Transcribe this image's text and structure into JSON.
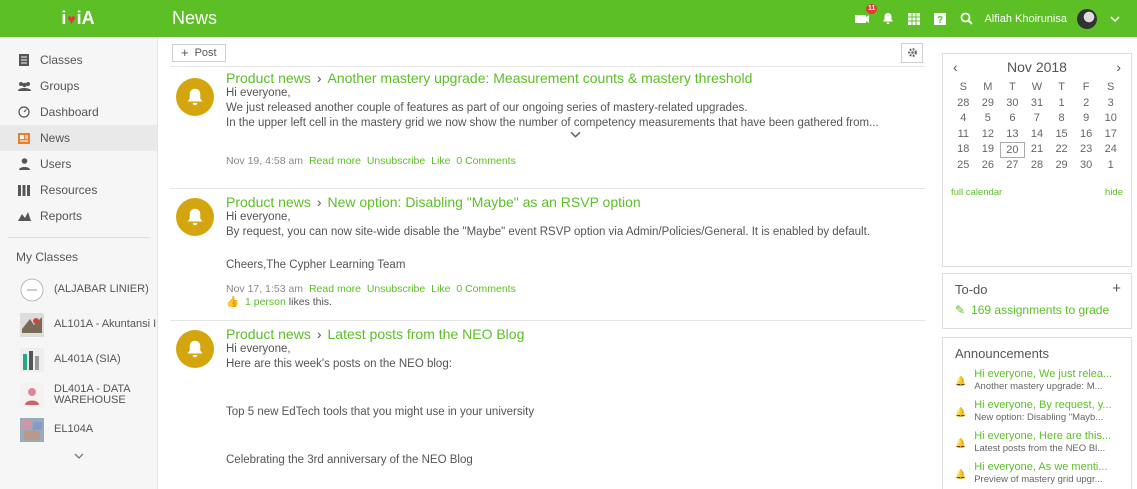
{
  "app": {
    "logo_text": "iYiA",
    "title": "News"
  },
  "topbar": {
    "notification_count": "11",
    "username": "Alfiah Khoirunisa"
  },
  "sidebar": {
    "nav": [
      {
        "label": "Classes",
        "icon": "classes-icon"
      },
      {
        "label": "Groups",
        "icon": "groups-icon"
      },
      {
        "label": "Dashboard",
        "icon": "dashboard-icon"
      },
      {
        "label": "News",
        "icon": "news-icon"
      },
      {
        "label": "Users",
        "icon": "users-icon"
      },
      {
        "label": "Resources",
        "icon": "resources-icon"
      },
      {
        "label": "Reports",
        "icon": "reports-icon"
      }
    ],
    "my_classes_label": "My Classes",
    "classes": [
      {
        "name": "(ALJABAR LINIER)"
      },
      {
        "name": "AL101A - Akuntansi I"
      },
      {
        "name": "AL401A (SIA)"
      },
      {
        "name": "DL401A - DATA WAREHOUSE"
      },
      {
        "name": "EL104A"
      }
    ]
  },
  "feed": {
    "post_button": "Post",
    "posts": [
      {
        "category": "Product news",
        "title": "Another mastery upgrade: Measurement counts & mastery threshold",
        "lines": [
          "Hi everyone,",
          "We just released another couple of features as part of our ongoing series of mastery-related upgrades.",
          "In the upper left cell in the mastery grid we now show the number of competency measurements that have been gathered from..."
        ],
        "date": "Nov 19, 4:58 am",
        "actions": [
          "Read more",
          "Unsubscribe",
          "Like",
          "0 Comments"
        ]
      },
      {
        "category": "Product news",
        "title": "New option: Disabling \"Maybe\" as an RSVP option",
        "lines": [
          "Hi everyone,",
          "By request, you can now site-wide disable the \"Maybe\" event RSVP option via Admin/Policies/General. It is enabled by default.",
          "",
          "Cheers,The Cypher Learning Team"
        ],
        "date": "Nov 17, 1:53 am",
        "actions": [
          "Read more",
          "Unsubscribe",
          "Like",
          "0 Comments"
        ],
        "likes_link": "1 person",
        "likes_text": "likes this."
      },
      {
        "category": "Product news",
        "title": "Latest posts from the NEO Blog",
        "lines": [
          "Hi everyone,",
          "Here are this week's posts on the NEO blog:",
          "",
          "",
          "Top 5 new EdTech tools that you might use in your university",
          "",
          "",
          "Celebrating the 3rd anniversary of the NEO Blog"
        ]
      }
    ]
  },
  "calendar": {
    "month": "Nov 2018",
    "dow": [
      "S",
      "M",
      "T",
      "W",
      "T",
      "F",
      "S"
    ],
    "weeks": [
      [
        "28",
        "29",
        "30",
        "31",
        "1",
        "2",
        "3"
      ],
      [
        "4",
        "5",
        "6",
        "7",
        "8",
        "9",
        "10"
      ],
      [
        "11",
        "12",
        "13",
        "14",
        "15",
        "16",
        "17"
      ],
      [
        "18",
        "19",
        "20",
        "21",
        "22",
        "23",
        "24"
      ],
      [
        "25",
        "26",
        "27",
        "28",
        "29",
        "30",
        "1"
      ]
    ],
    "today": "20",
    "full_calendar": "full calendar",
    "hide": "hide"
  },
  "todo": {
    "title": "To-do",
    "item": "169 assignments to grade"
  },
  "announcements": {
    "title": "Announcements",
    "items": [
      {
        "title": "Hi everyone, We just relea...",
        "sub": "Another mastery upgrade: M..."
      },
      {
        "title": "Hi everyone, By request, y...",
        "sub": "New option: Disabling \"Mayb..."
      },
      {
        "title": "Hi everyone, Here are this...",
        "sub": "Latest posts from the NEO Bl..."
      },
      {
        "title": "Hi everyone, As we menti...",
        "sub": "Preview of mastery grid upgr..."
      }
    ]
  },
  "colors": {
    "brand_green": "#5cbf26",
    "bell_gold": "#d4a50f",
    "news_orange": "#e8812c"
  }
}
